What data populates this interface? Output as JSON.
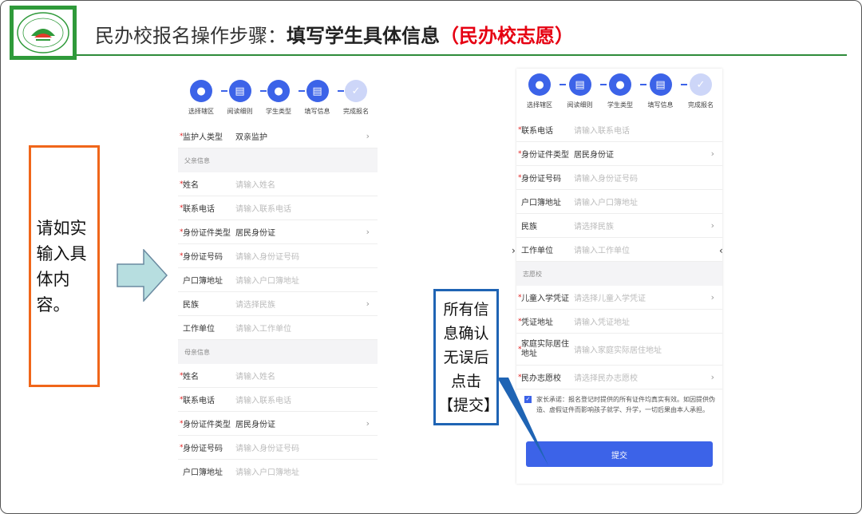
{
  "header": {
    "title_prefix": "民办校报名操作步骤：",
    "title_bold": "填写学生具体信息",
    "title_red": "（民办校志愿）"
  },
  "callouts": {
    "left": "请如实输入具体内容。",
    "right": "所有信息确认无误后点击【提交】"
  },
  "colors": {
    "accent": "#3c63e8",
    "brand_green": "#2e8b3a",
    "orange": "#f0661a",
    "blue": "#1f64b4",
    "red": "#e60012"
  },
  "steps": [
    {
      "label": "选择辖区",
      "icon": "location-icon"
    },
    {
      "label": "阅读细则",
      "icon": "document-icon"
    },
    {
      "label": "学生类型",
      "icon": "user-icon"
    },
    {
      "label": "填写信息",
      "icon": "form-icon"
    },
    {
      "label": "完成报名",
      "icon": "check-icon"
    }
  ],
  "left_form": {
    "guardian": {
      "label": "监护人类型",
      "value": "双亲监护"
    },
    "father_section": "父亲信息",
    "father": [
      {
        "label": "姓名",
        "placeholder": "请输入姓名"
      },
      {
        "label": "联系电话",
        "placeholder": "请输入联系电话"
      },
      {
        "label": "身份证件类型",
        "value": "居民身份证"
      },
      {
        "label": "身份证号码",
        "placeholder": "请输入身份证号码"
      },
      {
        "label": "户口簿地址",
        "placeholder": "请输入户口簿地址"
      },
      {
        "label": "民族",
        "placeholder": "请选择民族"
      },
      {
        "label": "工作单位",
        "placeholder": "请输入工作单位"
      }
    ],
    "mother_section": "母亲信息",
    "mother": [
      {
        "label": "姓名",
        "placeholder": "请输入姓名"
      },
      {
        "label": "联系电话",
        "placeholder": "请输入联系电话"
      },
      {
        "label": "身份证件类型",
        "value": "居民身份证"
      },
      {
        "label": "身份证号码",
        "placeholder": "请输入身份证号码"
      },
      {
        "label": "户口簿地址",
        "placeholder": "请输入户口簿地址"
      }
    ]
  },
  "right_form": {
    "rows": [
      {
        "label": "联系电话",
        "placeholder": "请输入联系电话"
      },
      {
        "label": "身份证件类型",
        "value": "居民身份证"
      },
      {
        "label": "身份证号码",
        "placeholder": "请输入身份证号码"
      },
      {
        "label": "户口簿地址",
        "placeholder": "请输入户口簿地址"
      },
      {
        "label": "民族",
        "placeholder": "请选择民族"
      },
      {
        "label": "工作单位",
        "placeholder": "请输入工作单位"
      }
    ],
    "wish_section": "志愿校",
    "wish": [
      {
        "label": "儿童入学凭证",
        "placeholder": "请选择儿童入学凭证"
      },
      {
        "label": "凭证地址",
        "placeholder": "请输入凭证地址"
      },
      {
        "label": "家庭实际居住地址",
        "placeholder": "请输入家庭实际居住地址"
      },
      {
        "label": "民办志愿校",
        "placeholder": "请选择民办志愿校"
      }
    ],
    "agreement": "家长承诺：报名登记时提供的所有证件均真实有效。如因提供伪造、虚假证件而影响孩子就学、升学，一切后果由本人承担。",
    "submit": "提交"
  }
}
